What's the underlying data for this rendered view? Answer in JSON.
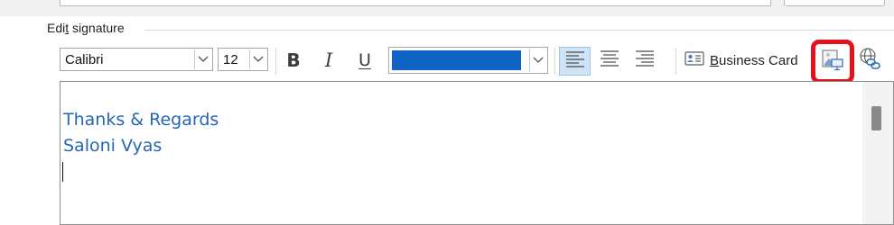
{
  "section": {
    "label_before_access": "Edi",
    "label_access_key": "t",
    "label_after_access": " signature"
  },
  "toolbar": {
    "font_name": "Calibri",
    "font_size": "12",
    "bold_label": "B",
    "italic_label": "I",
    "underline_label": "U",
    "font_color": "#0f63c2",
    "business_card_access_key": "B",
    "business_card_rest": "usiness Card"
  },
  "editor": {
    "lines": [
      "Thanks & Regards",
      "Saloni Vyas"
    ],
    "text_color": "#2566b8"
  },
  "highlight": {
    "color": "#e2121b",
    "target": "insert-picture-button"
  },
  "icons": {
    "business_card": "contact-card-icon",
    "insert_picture": "insert-picture-icon",
    "hyperlink": "globe-link-icon"
  }
}
